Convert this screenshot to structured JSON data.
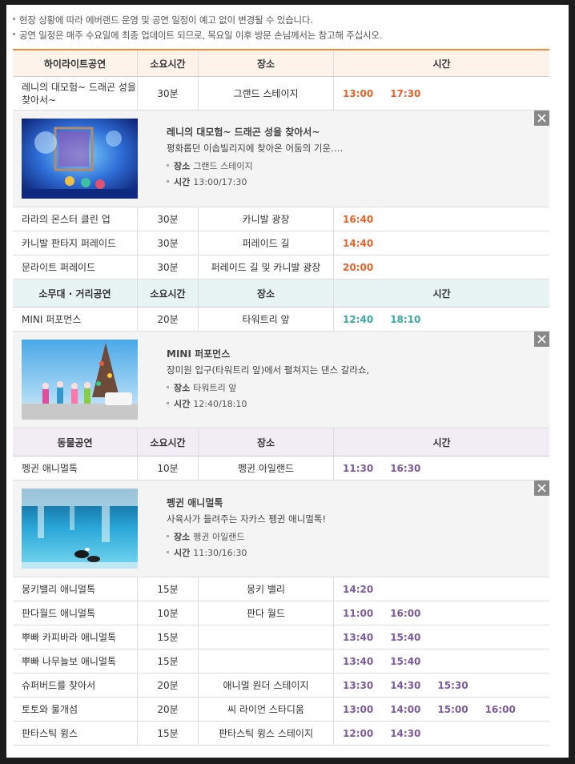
{
  "notices": [
    "현장 상황에 따라 에버랜드 운영 및 공연 일정이 예고 없이 변경될 수 있습니다.",
    "공연 일정은 매주 수요일에 최종 업데이트 되므로, 목요일 이후 방문 손님께서는 참고해 주십시오."
  ],
  "sections": [
    {
      "title": "하이라이트공연",
      "col_duration": "소요시간",
      "col_place": "장소",
      "col_time": "시간",
      "theme": "orange",
      "rows": [
        {
          "name": "레니의 대모험~ 드래곤 성을 찾아서~",
          "duration": "30분",
          "place": "그랜드 스테이지",
          "times": [
            "13:00",
            "17:30"
          ]
        },
        {
          "name": "라라의 몬스터 클린 업",
          "duration": "30분",
          "place": "카니발 광장",
          "times": [
            "16:40"
          ]
        },
        {
          "name": "카니발 판타지 퍼레이드",
          "duration": "30분",
          "place": "퍼레이드 길",
          "times": [
            "14:40"
          ]
        },
        {
          "name": "문라이트 퍼레이드",
          "duration": "30분",
          "place": "퍼레이드 길 및 카니발 광장",
          "times": [
            "20:00"
          ]
        }
      ],
      "detail": {
        "title": "레니의 대모험~ 드래곤 성을 찾아서~",
        "desc": "평화롭던 이솝빌리지에 찾아온 어둠의 기운….",
        "place_label": "장소",
        "place": "그랜드 스테이지",
        "time_label": "시간",
        "time": "13:00/17:30"
      }
    },
    {
      "title": "소무대 · 거리공연",
      "col_duration": "소요시간",
      "col_place": "장소",
      "col_time": "시간",
      "theme": "teal",
      "rows": [
        {
          "name": "MINI 퍼포먼스",
          "duration": "20분",
          "place": "타워트리 앞",
          "times": [
            "12:40",
            "18:10"
          ]
        }
      ],
      "detail": {
        "title": "MINI 퍼포먼스",
        "desc": "장미원 입구(타워트리 앞)에서 펼쳐지는 댄스 갈라쇼,",
        "place_label": "장소",
        "place": "타워트리 앞",
        "time_label": "시간",
        "time": "12:40/18:10"
      }
    },
    {
      "title": "동물공연",
      "col_duration": "소요시간",
      "col_place": "장소",
      "col_time": "시간",
      "theme": "purple",
      "rows": [
        {
          "name": "펭귄 애니멀톡",
          "duration": "10분",
          "place": "펭귄 아일랜드",
          "times": [
            "11:30",
            "16:30"
          ]
        },
        {
          "name": "몽키밸리 애니멀톡",
          "duration": "15분",
          "place": "몽키 밸리",
          "times": [
            "14:20"
          ]
        },
        {
          "name": "판다월드 애니멀톡",
          "duration": "10분",
          "place": "판다 월드",
          "times": [
            "11:00",
            "16:00"
          ]
        },
        {
          "name": "뿌빠 카피바라 애니멀톡",
          "duration": "15분",
          "place": "",
          "times": [
            "13:40",
            "15:40"
          ]
        },
        {
          "name": "뿌빠 나무늘보 애니멀톡",
          "duration": "15분",
          "place": "",
          "times": [
            "13:40",
            "15:40"
          ]
        },
        {
          "name": "슈퍼버드를 찾아서",
          "duration": "20분",
          "place": "애니멀 원더 스테이지",
          "times": [
            "13:30",
            "14:30",
            "15:30"
          ]
        },
        {
          "name": "토토와 물개섬",
          "duration": "20분",
          "place": "씨 라이언 스타디움",
          "times": [
            "13:00",
            "14:00",
            "15:00",
            "16:00"
          ]
        },
        {
          "name": "판타스틱 윙스",
          "duration": "15분",
          "place": "판타스틱 윙스 스테이지",
          "times": [
            "12:00",
            "14:30"
          ]
        }
      ],
      "detail": {
        "title": "펭귄 애니멀톡",
        "desc": "사육사가 들려주는 자카스 펭귄 애니멀톡!",
        "place_label": "장소",
        "place": "펭귄 아일랜드",
        "time_label": "시간",
        "time": "11:30/16:30"
      }
    }
  ],
  "icons": {
    "close": "close-icon",
    "bullet": "square-bullet-icon"
  },
  "colors": {
    "orange": "#e8622a",
    "teal": "#3aa8a0",
    "purple": "#7a5a9a",
    "header_border": "#f08a3c"
  }
}
